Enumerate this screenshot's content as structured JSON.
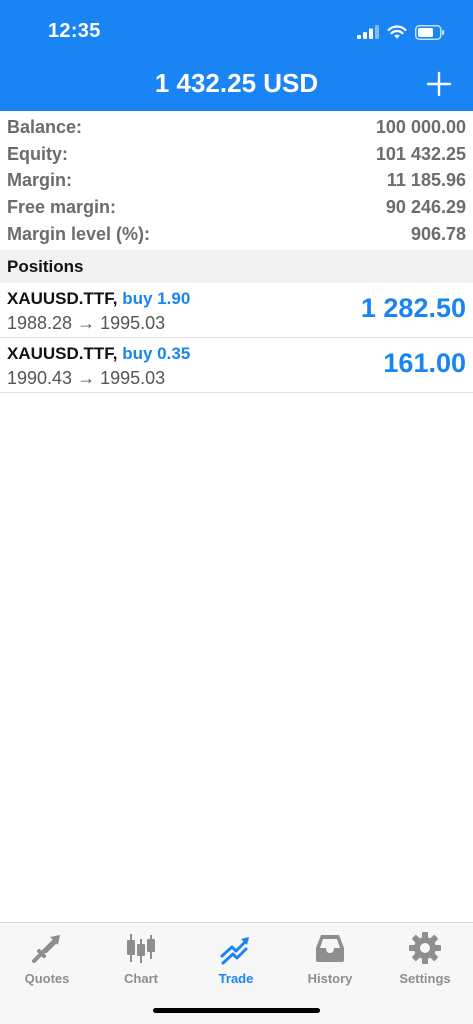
{
  "status_bar": {
    "time": "12:35"
  },
  "header": {
    "title": "1 432.25 USD"
  },
  "summary": [
    {
      "label": "Balance:",
      "value": "100 000.00"
    },
    {
      "label": "Equity:",
      "value": "101 432.25"
    },
    {
      "label": "Margin:",
      "value": "11 185.96"
    },
    {
      "label": "Free margin:",
      "value": "90 246.29"
    },
    {
      "label": "Margin level (%):",
      "value": "906.78"
    }
  ],
  "positions_title": "Positions",
  "positions": [
    {
      "symbol": "XAUUSD.TTF,",
      "direction": "buy 1.90",
      "prices": "1988.28 → 1995.03",
      "profit": "1 282.50"
    },
    {
      "symbol": "XAUUSD.TTF,",
      "direction": "buy 0.35",
      "prices": "1990.43 → 1995.03",
      "profit": "161.00"
    }
  ],
  "tabs": [
    {
      "label": "Quotes",
      "icon": "quotes-icon"
    },
    {
      "label": "Chart",
      "icon": "chart-icon"
    },
    {
      "label": "Trade",
      "icon": "trade-icon",
      "active": true
    },
    {
      "label": "History",
      "icon": "history-icon"
    },
    {
      "label": "Settings",
      "icon": "settings-icon"
    }
  ],
  "colors": {
    "accent": "#1a84f5",
    "inactive": "#8e8e8e"
  }
}
